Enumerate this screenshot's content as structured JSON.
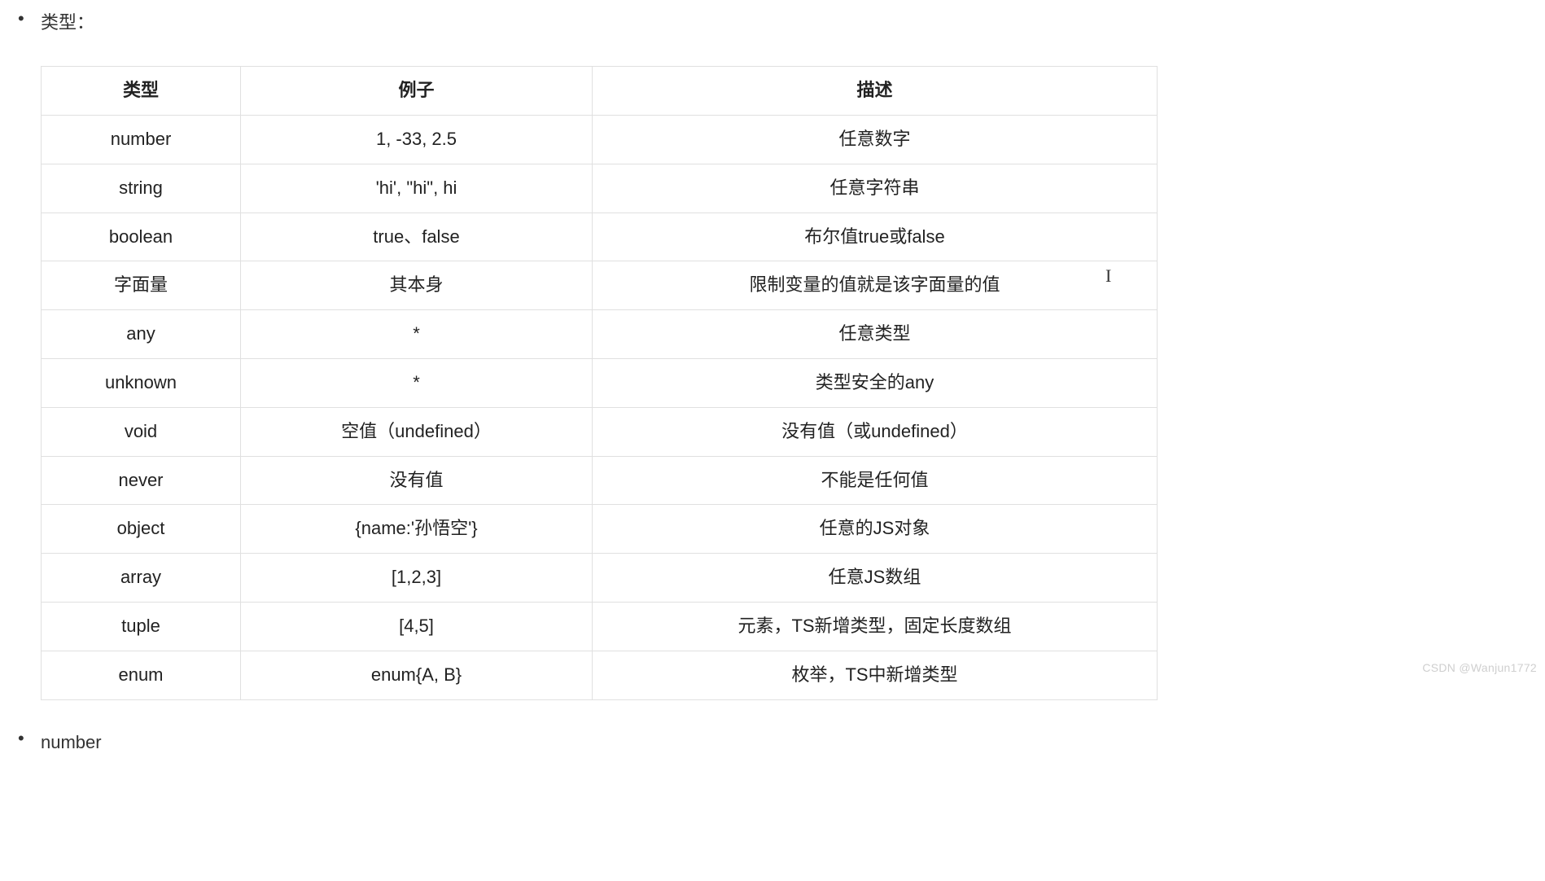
{
  "bullets": {
    "item1": "类型：",
    "item2": "number"
  },
  "table": {
    "headers": {
      "type": "类型",
      "example": "例子",
      "description": "描述"
    },
    "rows": [
      {
        "type": "number",
        "example": "1, -33, 2.5",
        "description": "任意数字"
      },
      {
        "type": "string",
        "example": "'hi', \"hi\", hi",
        "description": "任意字符串"
      },
      {
        "type": "boolean",
        "example": "true、false",
        "description": "布尔值true或false"
      },
      {
        "type": "字面量",
        "example": "其本身",
        "description": "限制变量的值就是该字面量的值"
      },
      {
        "type": "any",
        "example": "*",
        "description": "任意类型"
      },
      {
        "type": "unknown",
        "example": "*",
        "description": "类型安全的any"
      },
      {
        "type": "void",
        "example": "空值（undefined）",
        "description": "没有值（或undefined）"
      },
      {
        "type": "never",
        "example": "没有值",
        "description": "不能是任何值"
      },
      {
        "type": "object",
        "example": "{name:'孙悟空'}",
        "description": "任意的JS对象"
      },
      {
        "type": "array",
        "example": "[1,2,3]",
        "description": "任意JS数组"
      },
      {
        "type": "tuple",
        "example": "[4,5]",
        "description": "元素，TS新增类型，固定长度数组"
      },
      {
        "type": "enum",
        "example": "enum{A, B}",
        "description": "枚举，TS中新增类型"
      }
    ]
  },
  "watermark": "CSDN @Wanjun1772"
}
